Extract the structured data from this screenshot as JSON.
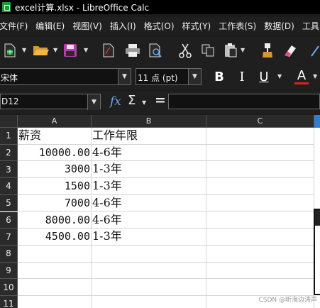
{
  "window": {
    "title": "excel计算.xlsx - LibreOffice Calc"
  },
  "menu": [
    "文件(F)",
    "编辑(E)",
    "视图(V)",
    "插入(I)",
    "格式(O)",
    "样式(Y)",
    "工作表(S)",
    "数据(D)",
    "工具"
  ],
  "toolbar": {
    "buttons": [
      "new-spreadsheet",
      "open",
      "save",
      "export-pdf",
      "print",
      "print-preview",
      "cut",
      "copy",
      "paste",
      "clone-formatting",
      "clear-formatting"
    ]
  },
  "format": {
    "font_name": "宋体",
    "font_size": "11 点 (pt)",
    "bold": "B",
    "italic": "I",
    "underline": "U",
    "font_color": "A"
  },
  "formula": {
    "name_box": "D12",
    "fx": "fx",
    "sum": "Σ",
    "equals": "="
  },
  "columns": [
    "A",
    "B",
    "C"
  ],
  "rows": [
    {
      "n": "1",
      "a": "薪资",
      "a_num": false,
      "b": "工作年限"
    },
    {
      "n": "2",
      "a": "10000.00",
      "a_num": true,
      "b": "4-6年"
    },
    {
      "n": "3",
      "a": "3000",
      "a_num": true,
      "b": "1-3年"
    },
    {
      "n": "4",
      "a": "1500",
      "a_num": true,
      "b": "1-3年"
    },
    {
      "n": "5",
      "a": "7000",
      "a_num": true,
      "b": "4-6年"
    },
    {
      "n": "6",
      "a": "8000.00",
      "a_num": true,
      "b": "4-6年"
    },
    {
      "n": "7",
      "a": "4500.00",
      "a_num": true,
      "b": "1-3年"
    },
    {
      "n": "8",
      "a": "",
      "a_num": false,
      "b": ""
    },
    {
      "n": "9",
      "a": "",
      "a_num": false,
      "b": ""
    },
    {
      "n": "10",
      "a": "",
      "a_num": false,
      "b": ""
    },
    {
      "n": "11",
      "a": "",
      "a_num": false,
      "b": ""
    }
  ],
  "watermark": "CSDN @昕海边涛声",
  "colors": {
    "accent": "#2f7fd0",
    "font_color_bar": "#e0201c",
    "save_icon": "#b040a8"
  }
}
